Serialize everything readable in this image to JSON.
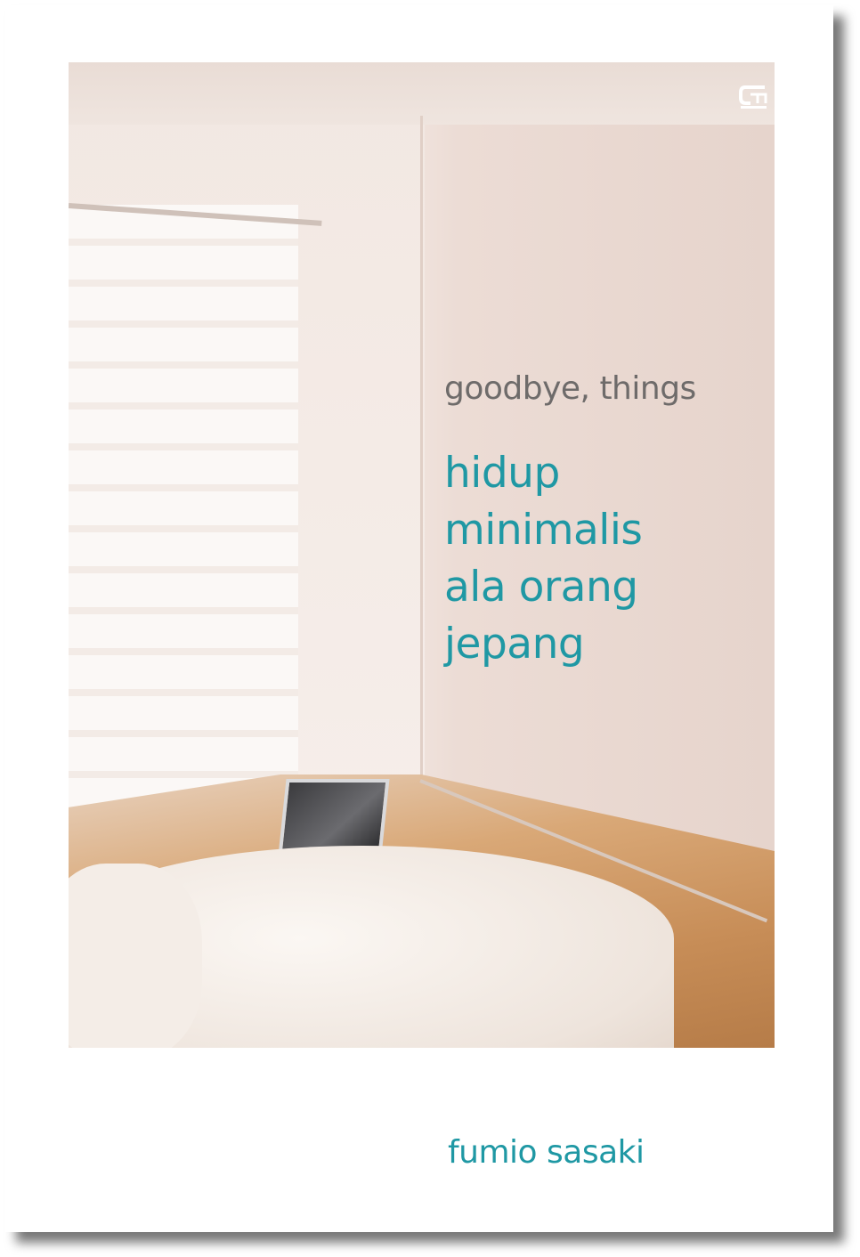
{
  "book": {
    "subtitle": "goodbye, things",
    "title_lines": [
      "hidup",
      "minimalis",
      "ala orang",
      "jepang"
    ],
    "author": "fumio sasaki",
    "publisher_logo": "GM",
    "colors": {
      "title": "#1f98a4",
      "subtitle": "#6e6b6a",
      "background": "#ffffff"
    }
  }
}
